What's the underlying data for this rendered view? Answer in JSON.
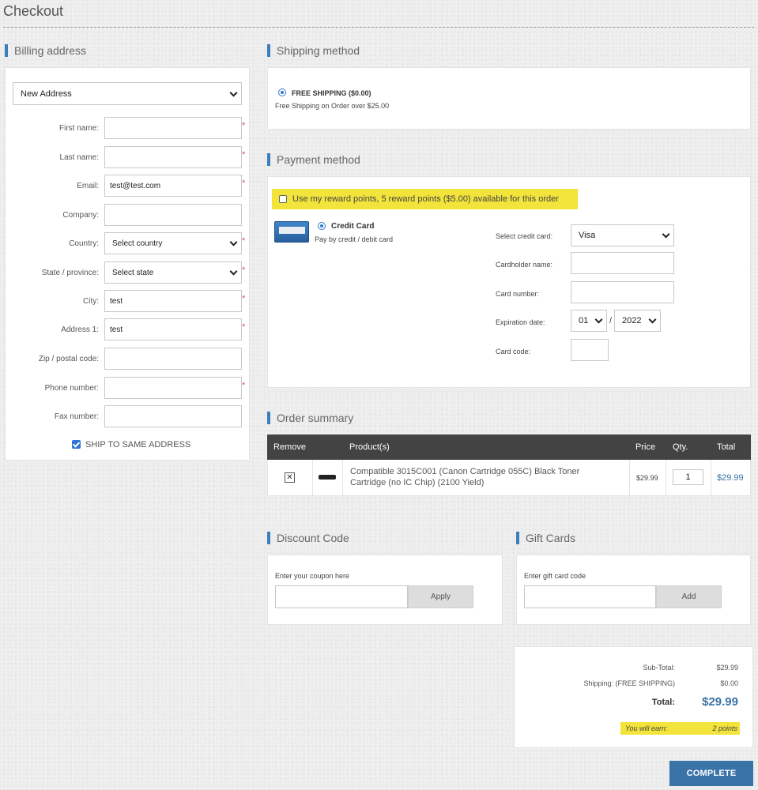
{
  "page": {
    "title": "Checkout"
  },
  "billing": {
    "heading": "Billing address",
    "address_select": "New Address",
    "fields": {
      "first_name": {
        "label": "First name:",
        "value": ""
      },
      "last_name": {
        "label": "Last name:",
        "value": ""
      },
      "email": {
        "label": "Email:",
        "value": "test@test.com"
      },
      "company": {
        "label": "Company:",
        "value": ""
      },
      "country": {
        "label": "Country:",
        "value": "Select country"
      },
      "state": {
        "label": "State / province:",
        "value": "Select state"
      },
      "city": {
        "label": "City:",
        "value": "test"
      },
      "address1": {
        "label": "Address 1:",
        "value": "test"
      },
      "zip": {
        "label": "Zip / postal code:",
        "value": ""
      },
      "phone": {
        "label": "Phone number:",
        "value": ""
      },
      "fax": {
        "label": "Fax number:",
        "value": ""
      }
    },
    "required_marker": "*",
    "ship_same_label": "SHIP TO SAME ADDRESS"
  },
  "shipping": {
    "heading": "Shipping method",
    "option_label": "FREE SHIPPING ($0.00)",
    "option_desc": "Free Shipping on Order over $25.00"
  },
  "payment": {
    "heading": "Payment method",
    "reward_label": "Use my reward points, 5 reward points ($5.00) available for this order",
    "method_label": "Credit Card",
    "method_desc": "Pay by credit / debit card",
    "card_type_label": "Select credit card:",
    "card_type_value": "Visa",
    "cardholder_label": "Cardholder name:",
    "card_number_label": "Card number:",
    "expiration_label": "Expiration date:",
    "exp_month": "01",
    "exp_sep": "/",
    "exp_year": "2022",
    "card_code_label": "Card code:"
  },
  "order_summary": {
    "heading": "Order summary",
    "columns": {
      "remove": "Remove",
      "product": "Product(s)",
      "price": "Price",
      "qty": "Qty.",
      "total": "Total"
    },
    "rows": [
      {
        "product": "Compatible 3015C001 (Canon Cartridge 055C) Black Toner Cartridge (no IC Chip) (2100 Yield)",
        "price": "$29.99",
        "qty": "1",
        "total": "$29.99"
      }
    ]
  },
  "discount": {
    "heading": "Discount Code",
    "label": "Enter your coupon here",
    "button": "Apply"
  },
  "gift": {
    "heading": "Gift Cards",
    "label": "Enter gift card code",
    "button": "Add"
  },
  "totals": {
    "subtotal_label": "Sub-Total:",
    "subtotal_value": "$29.99",
    "shipping_label": "Shipping: (FREE SHIPPING)",
    "shipping_value": "$0.00",
    "total_label": "Total:",
    "total_value": "$29.99",
    "earn_label": "You will earn:",
    "earn_value": "2 points"
  },
  "complete_button": "COMPLETE",
  "colors": {
    "accent": "#3b7dbd",
    "button_blue": "#3a73a8",
    "highlight_yellow": "#f2e43b",
    "required_red": "#d9534f",
    "table_header": "#434343"
  }
}
